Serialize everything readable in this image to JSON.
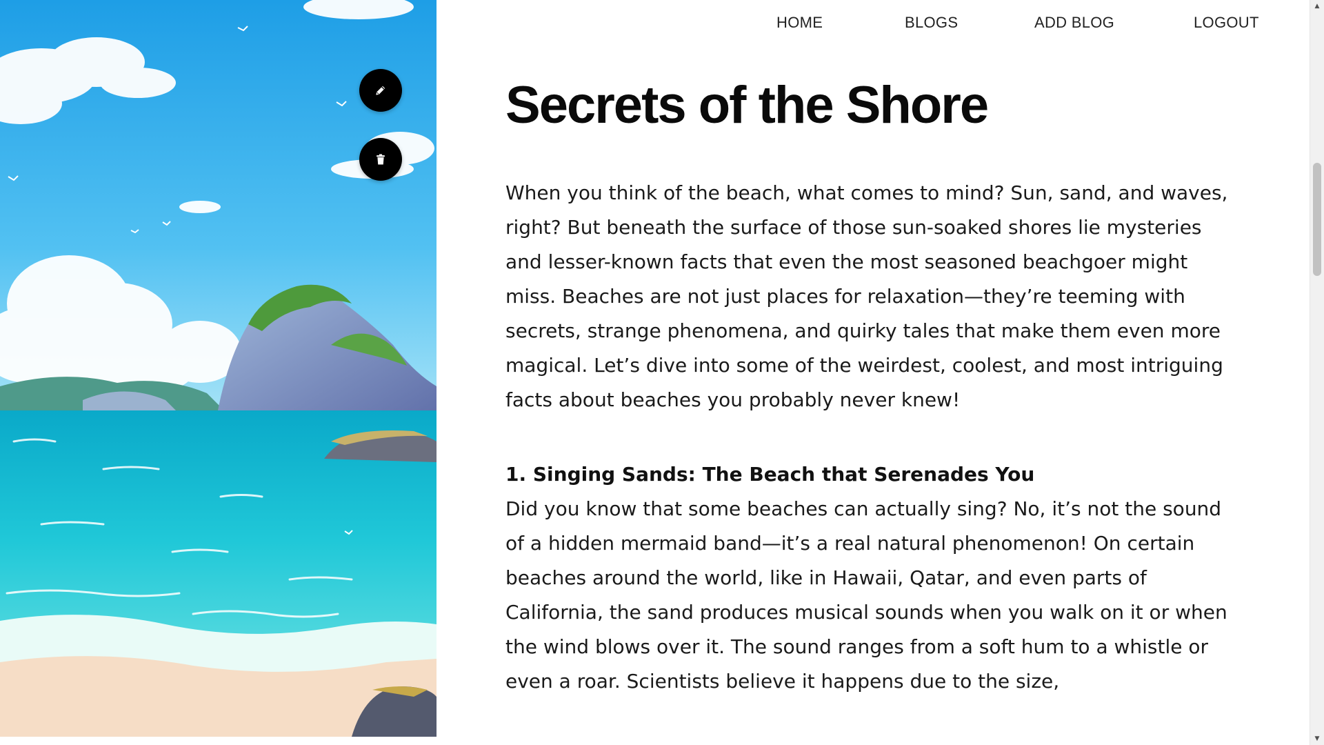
{
  "nav": {
    "items": [
      {
        "label": "HOME"
      },
      {
        "label": "BLOGS"
      },
      {
        "label": "ADD BLOG"
      },
      {
        "label": "LOGOUT"
      }
    ]
  },
  "actions": {
    "edit_icon": "pencil-icon",
    "delete_icon": "trash-icon"
  },
  "hero_image": {
    "subject": "anime-style beach scene with turquoise sea, rocky island and clouds"
  },
  "article": {
    "title": "Secrets of the Shore",
    "intro": "When you think of the beach, what comes to mind? Sun, sand, and waves, right? But beneath the surface of those sun-soaked shores lie mysteries and lesser-known facts that even the most seasoned beachgoer might miss. Beaches are not just places for relaxation—they’re teeming with secrets, strange phenomena, and quirky tales that make them even more magical. Let’s dive into some of the weirdest, coolest, and most intriguing facts about beaches you probably never knew!",
    "sections": [
      {
        "heading": "1. Singing Sands: The Beach that Serenades You",
        "text": "Did you know that some beaches can actually sing? No, it’s not the sound of a hidden mermaid band—it’s a real natural phenomenon! On certain beaches around the world, like in Hawaii, Qatar, and even parts of California, the sand produces musical sounds when you walk on it or when the wind blows over it. The sound ranges from a soft hum to a whistle or even a roar. Scientists believe it happens due to the size,"
      }
    ]
  },
  "colors": {
    "sky": "#3fb2ee",
    "sea": "#21c7d6",
    "fab_bg": "#000000",
    "text": "#1a1a1a"
  }
}
